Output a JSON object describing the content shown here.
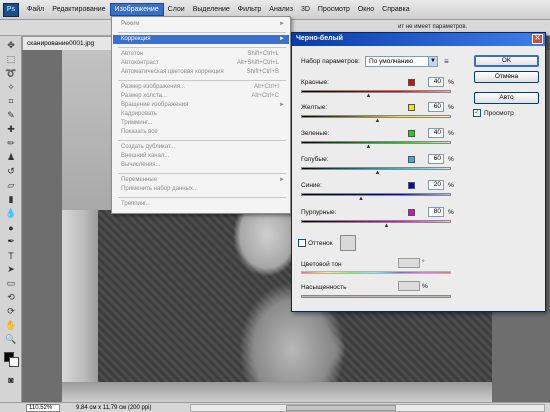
{
  "menubar": {
    "logo": "Ps",
    "items": [
      "Файл",
      "Редактирование",
      "Изображение",
      "Слои",
      "Выделение",
      "Фильтр",
      "Анализ",
      "3D",
      "Просмотр",
      "Окно",
      "Справка"
    ]
  },
  "optbar": {
    "message": "ит не имеет параметров."
  },
  "document": {
    "tab_title": "сканирование0001.jpg"
  },
  "statusbar": {
    "zoom": "110,52%",
    "info": "9,84 см x 11,79 см (200 ppi)"
  },
  "image_menu": {
    "items": [
      {
        "label": "Режим",
        "shortcut": "",
        "arrow": "►"
      },
      {
        "label": "Коррекция",
        "shortcut": "",
        "arrow": "►"
      },
      {
        "label": "Автотон",
        "shortcut": "Shift+Ctrl+L",
        "arrow": ""
      },
      {
        "label": "Автоконтраст",
        "shortcut": "Alt+Shift+Ctrl+L",
        "arrow": ""
      },
      {
        "label": "Автоматическая цветовая коррекция",
        "shortcut": "Shift+Ctrl+B",
        "arrow": ""
      },
      {
        "label": "Размер изображения...",
        "shortcut": "Alt+Ctrl+I",
        "arrow": ""
      },
      {
        "label": "Размер холста...",
        "shortcut": "Alt+Ctrl+C",
        "arrow": ""
      },
      {
        "label": "Вращение изображения",
        "shortcut": "",
        "arrow": "►"
      },
      {
        "label": "Кадрировать",
        "shortcut": "",
        "arrow": ""
      },
      {
        "label": "Тримминг...",
        "shortcut": "",
        "arrow": ""
      },
      {
        "label": "Показать все",
        "shortcut": "",
        "arrow": ""
      },
      {
        "label": "Создать дубликат...",
        "shortcut": "",
        "arrow": ""
      },
      {
        "label": "Внешний канал...",
        "shortcut": "",
        "arrow": ""
      },
      {
        "label": "Вычисления...",
        "shortcut": "",
        "arrow": ""
      },
      {
        "label": "Переменные",
        "shortcut": "",
        "arrow": "►"
      },
      {
        "label": "Применить набор данных...",
        "shortcut": "",
        "arrow": ""
      },
      {
        "label": "Треппинг...",
        "shortcut": "",
        "arrow": ""
      }
    ]
  },
  "dialog": {
    "title": "Черно-белый",
    "close": "✕",
    "preset_label": "Набор параметров:",
    "preset_value": "По умолчанию",
    "ok": "OK",
    "cancel": "Отмена",
    "auto": "Авто",
    "preview": "Просмотр",
    "preview_checked": "✓",
    "sliders": [
      {
        "label": "Красные:",
        "value": "40",
        "unit": "%",
        "color": "#e00000",
        "track": "linear-gradient(90deg,#000,#7a0000,#ff0000,#ffb0b0)",
        "pos": 0.45
      },
      {
        "label": "Желтые:",
        "value": "60",
        "unit": "%",
        "color": "#f2e400",
        "track": "linear-gradient(90deg,#000,#6b6600,#ffee00,#fffbb0)",
        "pos": 0.51
      },
      {
        "label": "Зеленые:",
        "value": "40",
        "unit": "%",
        "color": "#1fd21f",
        "track": "linear-gradient(90deg,#000,#006b00,#00e000,#b8ffb8)",
        "pos": 0.45
      },
      {
        "label": "Голубые:",
        "value": "60",
        "unit": "%",
        "color": "#2eb0e0",
        "track": "linear-gradient(90deg,#000,#006a7a,#00d0e8,#b8f4ff)",
        "pos": 0.51
      },
      {
        "label": "Синие:",
        "value": "20",
        "unit": "%",
        "color": "#0000dd",
        "track": "linear-gradient(90deg,#000,#00007a,#0000ff,#b8b8ff)",
        "pos": 0.4
      },
      {
        "label": "Пурпурные:",
        "value": "80",
        "unit": "%",
        "color": "#e000c8",
        "track": "linear-gradient(90deg,#000,#700060,#ff00d8,#ffc0f4)",
        "pos": 0.57
      }
    ],
    "tint_label": "Оттенок",
    "hue_label": "Цветовой тон",
    "hue_unit": "°",
    "saturation_label": "Насыщенность",
    "saturation_unit": "%"
  }
}
